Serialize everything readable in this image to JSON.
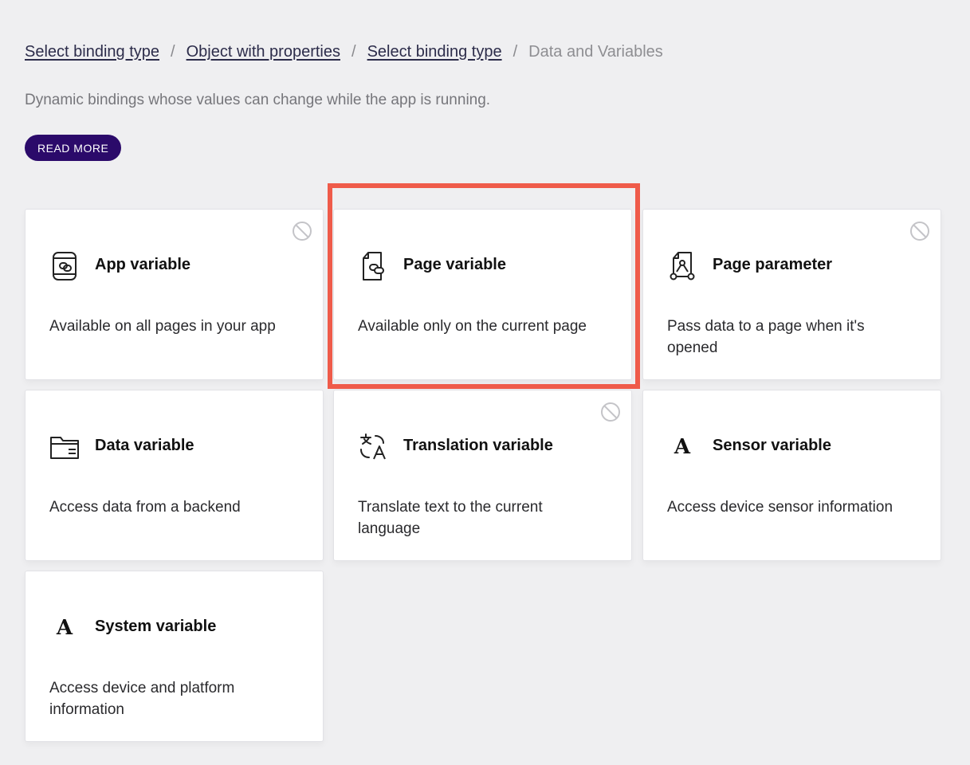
{
  "breadcrumb": {
    "items": [
      {
        "label": "Select binding type"
      },
      {
        "label": "Object with properties"
      },
      {
        "label": "Select binding type"
      }
    ],
    "separator": "/",
    "current": "Data and Variables"
  },
  "description": "Dynamic bindings whose values can change while the app is running.",
  "read_more_label": "READ MORE",
  "cards": [
    {
      "title": "App variable",
      "description": "Available on all pages in your app",
      "icon": "app-variable-icon",
      "disabled": true
    },
    {
      "title": "Page variable",
      "description": "Available only on the current page",
      "icon": "page-variable-icon",
      "disabled": false,
      "highlighted": true
    },
    {
      "title": "Page parameter",
      "description": "Pass data to a page when it's opened",
      "icon": "page-parameter-icon",
      "disabled": true
    },
    {
      "title": "Data variable",
      "description": "Access data from a backend",
      "icon": "folder-icon",
      "disabled": false
    },
    {
      "title": "Translation variable",
      "description": "Translate text to the current language",
      "icon": "translate-icon",
      "disabled": true
    },
    {
      "title": "Sensor variable",
      "description": "Access device sensor information",
      "icon": "serif-a-icon",
      "icon_glyph": "A",
      "disabled": false
    },
    {
      "title": "System variable",
      "description": "Access device and platform information",
      "icon": "serif-a-icon",
      "icon_glyph": "A",
      "disabled": false
    }
  ],
  "colors": {
    "background": "#efeff1",
    "accent_button": "#2b0a6a",
    "highlight_border": "#ef5b4a",
    "card_background": "#ffffff"
  }
}
